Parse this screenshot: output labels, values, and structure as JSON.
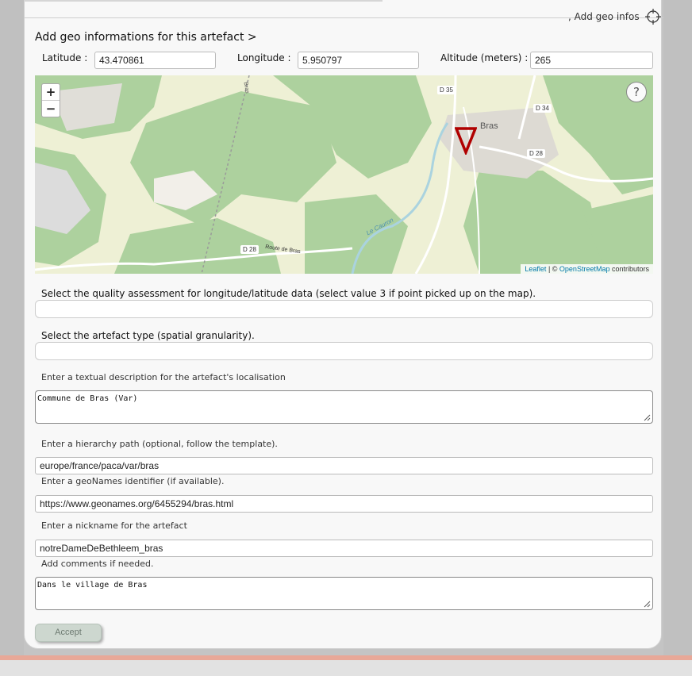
{
  "header": {
    "add_geo_link": ", Add geo infos",
    "crosshair_icon": "crosshair-icon"
  },
  "title": "Add geo informations for this artefact >",
  "coords": {
    "latitude_label": "Latitude :",
    "latitude_value": "43.470861",
    "longitude_label": "Longitude :",
    "longitude_value": "5.950797",
    "altitude_label": "Altitude (meters) :",
    "altitude_value": "265"
  },
  "map": {
    "zoom_in": "+",
    "zoom_out": "−",
    "help": "?",
    "labels": {
      "d35": "D 35",
      "d34": "D 34",
      "d28_east": "D 28",
      "d28_west": "D 28",
      "bras": "Bras",
      "route": "Route de Bras",
      "river": "Le Cauron",
      "road_vertical": "Bras"
    },
    "attribution_leaflet": "Leaflet",
    "attribution_sep": " | © ",
    "attribution_osm": "OpenStreetMap",
    "attribution_suffix": " contributors",
    "colors": {
      "forest": "#add19e",
      "open": "#f2efe9",
      "farmland": "#eef0d5",
      "water": "#aad3df",
      "marker": "#b00000"
    }
  },
  "form": {
    "quality_label": "Select the quality assessment for longitude/latitude data (select value 3 if point picked up on the map).",
    "type_label": "Select the artefact type (spatial granularity).",
    "description_label": "Enter a textual description for the artefact's localisation",
    "description_value": "Commune de Bras (Var)",
    "hierarchy_label": "Enter a hierarchy path (optional, follow the template).",
    "hierarchy_value": "europe/france/paca/var/bras",
    "geonames_label": "Enter a geoNames identifier (if available).",
    "geonames_value": "https://www.geonames.org/6455294/bras.html",
    "nickname_label": "Enter a nickname for the artefact",
    "nickname_value": "notreDameDeBethleem_bras",
    "comments_label": "Add comments if needed.",
    "comments_value": "Dans le village de Bras",
    "accept_label": "Accept"
  }
}
